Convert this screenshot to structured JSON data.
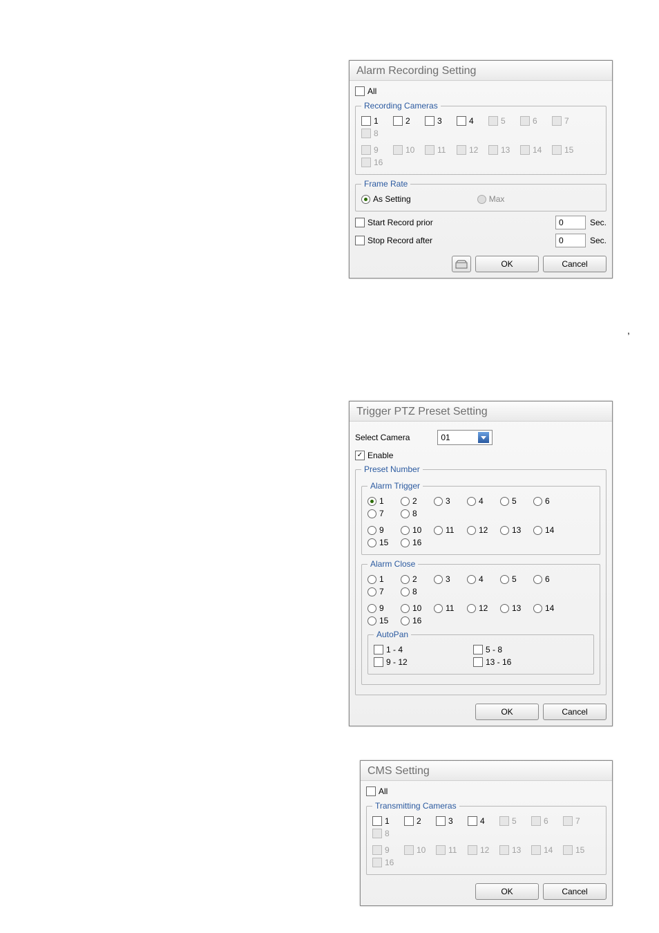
{
  "alarm": {
    "title": "Alarm Recording Setting",
    "all_label": "All",
    "cameras_legend": "Recording Cameras",
    "cam_labels": [
      "1",
      "2",
      "3",
      "4",
      "5",
      "6",
      "7",
      "8",
      "9",
      "10",
      "11",
      "12",
      "13",
      "14",
      "15",
      "16"
    ],
    "frame_legend": "Frame Rate",
    "as_setting": "As Setting",
    "max": "Max",
    "start_prior": "Start Record prior",
    "stop_after": "Stop Record after",
    "sec": "Sec.",
    "start_val": "0",
    "stop_val": "0",
    "ok": "OK",
    "cancel": "Cancel"
  },
  "ptz": {
    "title": "Trigger PTZ Preset Setting",
    "select_camera": "Select Camera",
    "camera_val": "01",
    "enable": "Enable",
    "preset_legend": "Preset Number",
    "trigger_legend": "Alarm Trigger",
    "close_legend": "Alarm Close",
    "nums": [
      "1",
      "2",
      "3",
      "4",
      "5",
      "6",
      "7",
      "8",
      "9",
      "10",
      "11",
      "12",
      "13",
      "14",
      "15",
      "16"
    ],
    "autopan_legend": "AutoPan",
    "ap1": "1 - 4",
    "ap2": "5 - 8",
    "ap3": "9 - 12",
    "ap4": "13 - 16",
    "ok": "OK",
    "cancel": "Cancel"
  },
  "cms": {
    "title": "CMS Setting",
    "all_label": "All",
    "legend": "Transmitting Cameras",
    "cam_labels": [
      "1",
      "2",
      "3",
      "4",
      "5",
      "6",
      "7",
      "8",
      "9",
      "10",
      "11",
      "12",
      "13",
      "14",
      "15",
      "16"
    ],
    "ok": "OK",
    "cancel": "Cancel"
  }
}
